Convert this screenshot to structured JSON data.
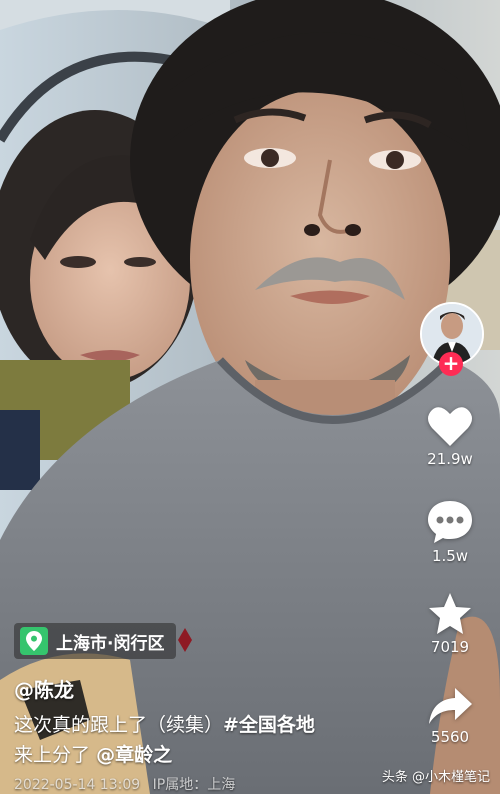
{
  "location": {
    "text": "上海市·闵行区",
    "icon": "map-pin-icon"
  },
  "author": {
    "name": "@陈龙"
  },
  "caption": {
    "line1_text": "这次真的跟上了（续集）",
    "hashtag": "#全国各地",
    "line2_text": "来上分了",
    "mention": "@章龄之"
  },
  "meta": {
    "timestamp": "2022-05-14 13:09",
    "ip_label": "IP属地：上海"
  },
  "actions": {
    "like": {
      "icon": "heart-icon",
      "count": "21.9w"
    },
    "comment": {
      "icon": "comment-icon",
      "count": "1.5w"
    },
    "favorite": {
      "icon": "star-icon",
      "count": "7019"
    },
    "share": {
      "icon": "share-arrow-icon",
      "count": "5560"
    },
    "follow": {
      "icon": "plus-icon",
      "label": "+"
    }
  },
  "watermark": {
    "text": "头条 @小木槿笔记"
  },
  "colors": {
    "follow": "#fe2c55",
    "location_pin": "#35c46d"
  }
}
